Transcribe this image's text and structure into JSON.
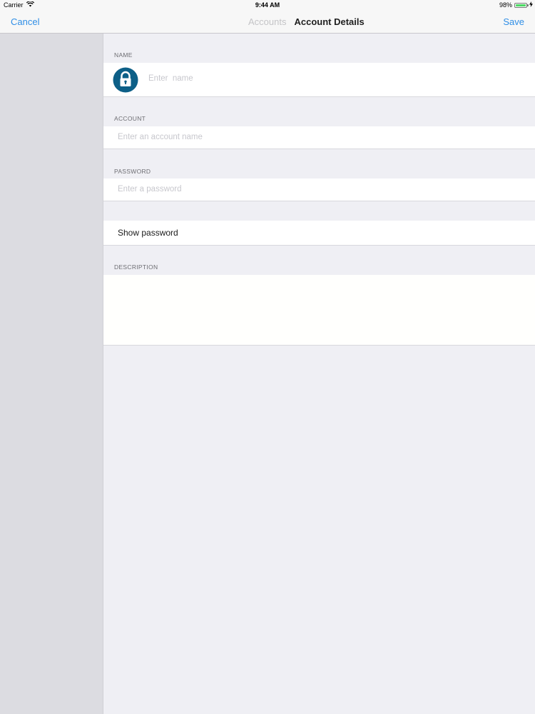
{
  "status_bar": {
    "carrier": "Carrier",
    "time": "9:44 AM",
    "battery_percent": "98%",
    "battery_level": 0.98,
    "battery_color": "#4cd964",
    "icons": [
      "wifi-icon",
      "battery-icon",
      "charging-icon"
    ]
  },
  "nav": {
    "cancel_label": "Cancel",
    "back_title": "Accounts",
    "title": "Account Details",
    "save_label": "Save",
    "accent_color": "#2f8ee6"
  },
  "form": {
    "name": {
      "header": "NAME",
      "placeholder": "Enter  name",
      "value": "",
      "icon": "lock-icon",
      "icon_color": "#0d5f87"
    },
    "account": {
      "header": "ACCOUNT",
      "placeholder": "Enter an account name",
      "value": ""
    },
    "password": {
      "header": "PASSWORD",
      "placeholder": "Enter a password",
      "value": ""
    },
    "show_password": {
      "label": "Show password"
    },
    "description": {
      "header": "DESCRIPTION",
      "value": ""
    }
  }
}
